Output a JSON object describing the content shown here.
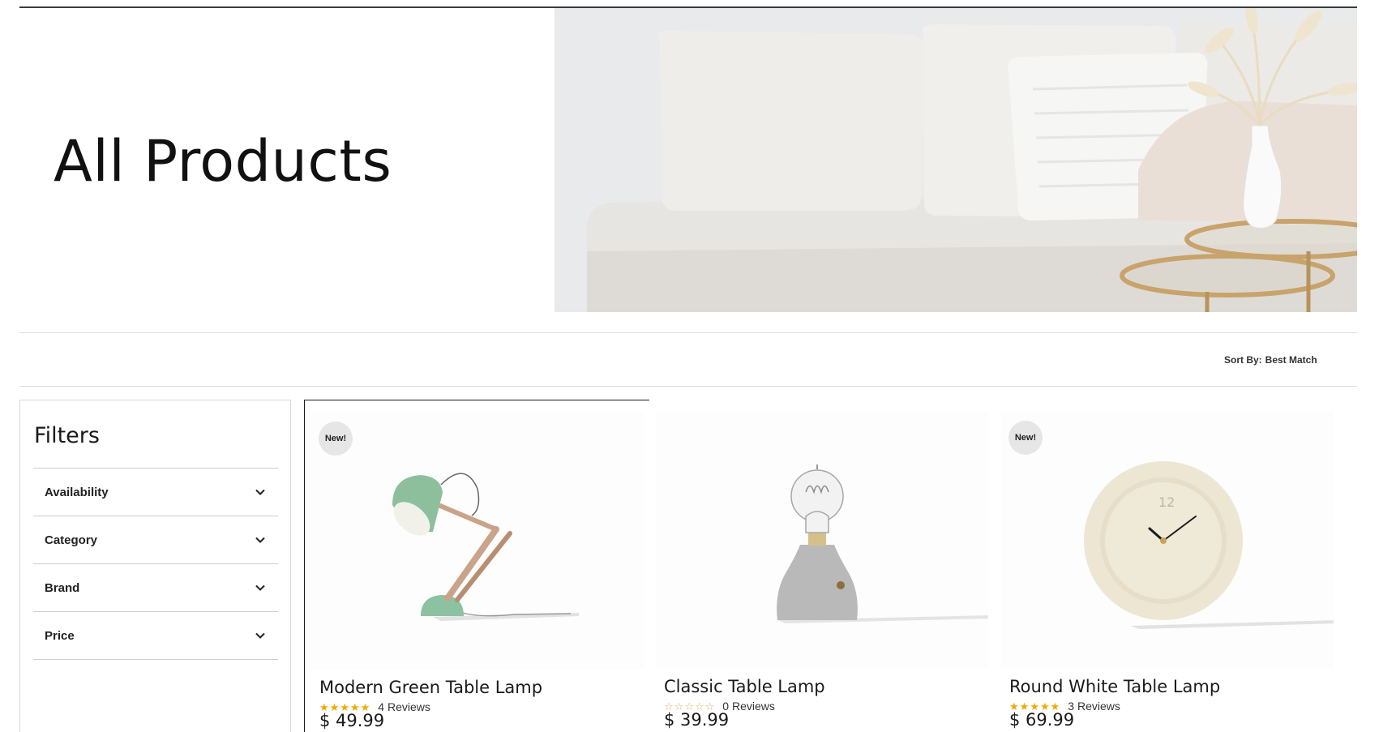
{
  "page": {
    "title": "All Products"
  },
  "sort": {
    "label": "Sort By:",
    "value": "Best Match"
  },
  "filters": {
    "title": "Filters",
    "items": [
      {
        "label": "Availability"
      },
      {
        "label": "Category"
      },
      {
        "label": "Brand"
      },
      {
        "label": "Price"
      }
    ]
  },
  "products": [
    {
      "name": "Modern Green Table Lamp",
      "badge": "New!",
      "rating": 5,
      "reviews": "4 Reviews",
      "price": "$ 49.99",
      "image": "green-desk-lamp"
    },
    {
      "name": "Classic Table Lamp",
      "badge": "",
      "rating": 0,
      "reviews": "0 Reviews",
      "price": "$ 39.99",
      "image": "concrete-bulb-lamp"
    },
    {
      "name": "Round White Table Lamp",
      "badge": "New!",
      "rating": 5,
      "reviews": "3 Reviews",
      "price": "$ 69.99",
      "image": "round-white-clock"
    }
  ],
  "colors": {
    "accent_star": "#f2a900",
    "border": "#d9d9d9",
    "text": "#1a1a1a"
  }
}
